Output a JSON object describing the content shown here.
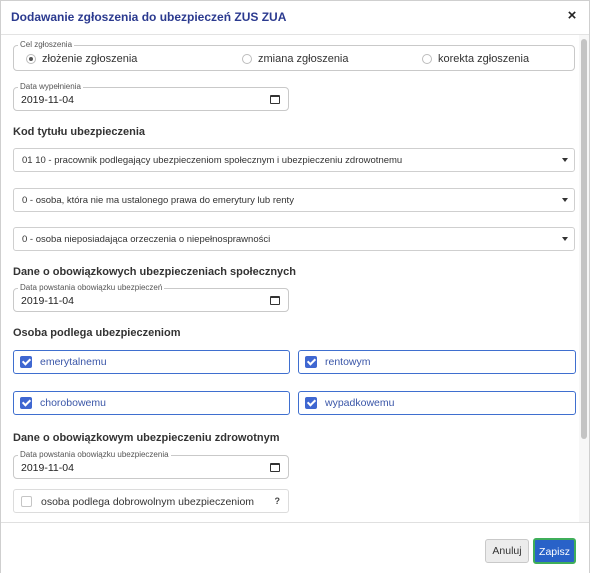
{
  "dialog": {
    "title": "Dodawanie zgłoszenia do ubezpieczeń ZUS ZUA",
    "close_glyph": "×"
  },
  "purpose": {
    "legend": "Cel zgłoszenia",
    "options": [
      {
        "label": "złożenie zgłoszenia",
        "selected": true
      },
      {
        "label": "zmiana zgłoszenia",
        "selected": false
      },
      {
        "label": "korekta zgłoszenia",
        "selected": false
      }
    ]
  },
  "fill_date": {
    "legend": "Data wypełnienia",
    "value": "2019-11-04"
  },
  "insurance_code": {
    "heading": "Kod tytułu ubezpieczenia",
    "selects": [
      "01 10 - pracownik podlegający ubezpieczeniom społecznym i ubezpieczeniu zdrowotnemu",
      "0 - osoba, która nie ma ustalonego prawa do emerytury lub renty",
      "0 - osoba nieposiadająca orzeczenia o niepełnosprawności"
    ]
  },
  "social": {
    "heading": "Dane o obowiązkowych ubezpieczeniach społecznych",
    "date_legend": "Data powstania obowiązku ubezpieczeń",
    "date_value": "2019-11-04"
  },
  "subject": {
    "heading": "Osoba podlega ubezpieczeniom",
    "checkboxes": [
      {
        "label": "emerytalnemu",
        "checked": true
      },
      {
        "label": "rentowym",
        "checked": true
      },
      {
        "label": "chorobowemu",
        "checked": true
      },
      {
        "label": "wypadkowemu",
        "checked": true
      }
    ]
  },
  "health": {
    "heading": "Dane o obowiązkowym ubezpieczeniu zdrowotnym",
    "date_legend": "Data powstania obowiązku ubezpieczenia",
    "date_value": "2019-11-04"
  },
  "voluntary": {
    "label": "osoba podlega dobrowolnym ubezpieczeniom",
    "checked": false,
    "help": "?"
  },
  "footer": {
    "cancel_label": "Anuluj",
    "save_label": "Zapisz"
  },
  "colors": {
    "title": "#2b3a8f",
    "accent": "#3f67d1",
    "save_bg": "#2962c8",
    "save_border": "#3fae5a"
  },
  "icons": {
    "close": "close-icon",
    "calendar": "calendar-icon",
    "caret": "chevron-down-icon",
    "check": "checkmark-icon",
    "help": "question-icon"
  }
}
